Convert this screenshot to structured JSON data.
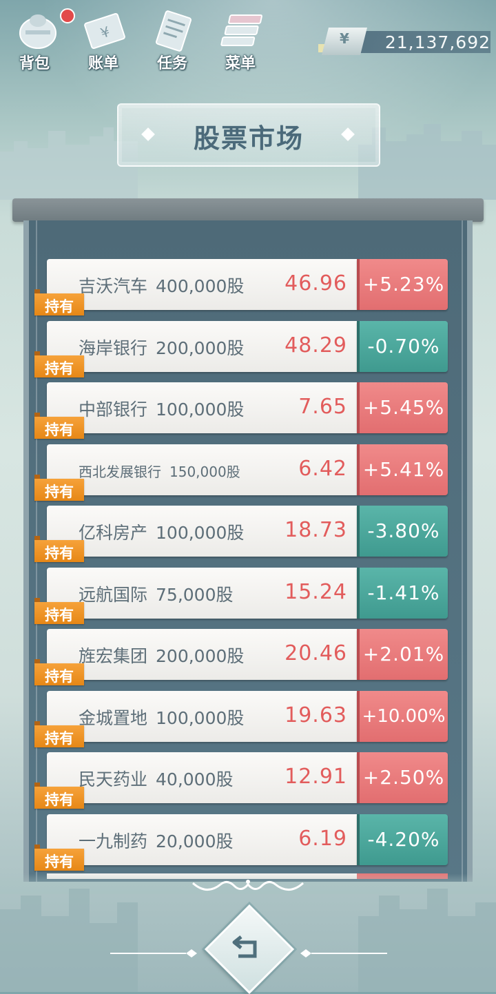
{
  "topbar": {
    "buttons": [
      {
        "label": "背包",
        "icon": "backpack-icon",
        "badge": true
      },
      {
        "label": "账单",
        "icon": "bill-icon",
        "badge": false
      },
      {
        "label": "任务",
        "icon": "task-icon",
        "badge": false
      },
      {
        "label": "菜单",
        "icon": "menu-icon",
        "badge": false
      }
    ],
    "money": {
      "symbol": "¥",
      "value": "21,137,692"
    }
  },
  "title": "股票市场",
  "hold_label": "持有",
  "stocks": [
    {
      "name": "吉沃汽车",
      "shares": "400,000股",
      "price": "46.96",
      "change": "+5.23%",
      "trend": "up"
    },
    {
      "name": "海岸银行",
      "shares": "200,000股",
      "price": "48.29",
      "change": "-0.70%",
      "trend": "down"
    },
    {
      "name": "中部银行",
      "shares": "100,000股",
      "price": "7.65",
      "change": "+5.45%",
      "trend": "up"
    },
    {
      "name": "西北发展银行",
      "shares": "150,000股",
      "price": "6.42",
      "change": "+5.41%",
      "trend": "up"
    },
    {
      "name": "亿科房产",
      "shares": "100,000股",
      "price": "18.73",
      "change": "-3.80%",
      "trend": "down"
    },
    {
      "name": "远航国际",
      "shares": "75,000股",
      "price": "15.24",
      "change": "-1.41%",
      "trend": "down"
    },
    {
      "name": "旌宏集团",
      "shares": "200,000股",
      "price": "20.46",
      "change": "+2.01%",
      "trend": "up"
    },
    {
      "name": "金城置地",
      "shares": "100,000股",
      "price": "19.63",
      "change": "+10.00%",
      "trend": "up"
    },
    {
      "name": "民天药业",
      "shares": "40,000股",
      "price": "12.91",
      "change": "+2.50%",
      "trend": "up"
    },
    {
      "name": "一九制药",
      "shares": "20,000股",
      "price": "6.19",
      "change": "-4.20%",
      "trend": "down"
    }
  ],
  "colors": {
    "price": "#e25c5c",
    "up": "#e26e70",
    "down": "#3f9a8f",
    "hold": "#f0961f"
  },
  "back_button_icon": "return-arrow-icon"
}
